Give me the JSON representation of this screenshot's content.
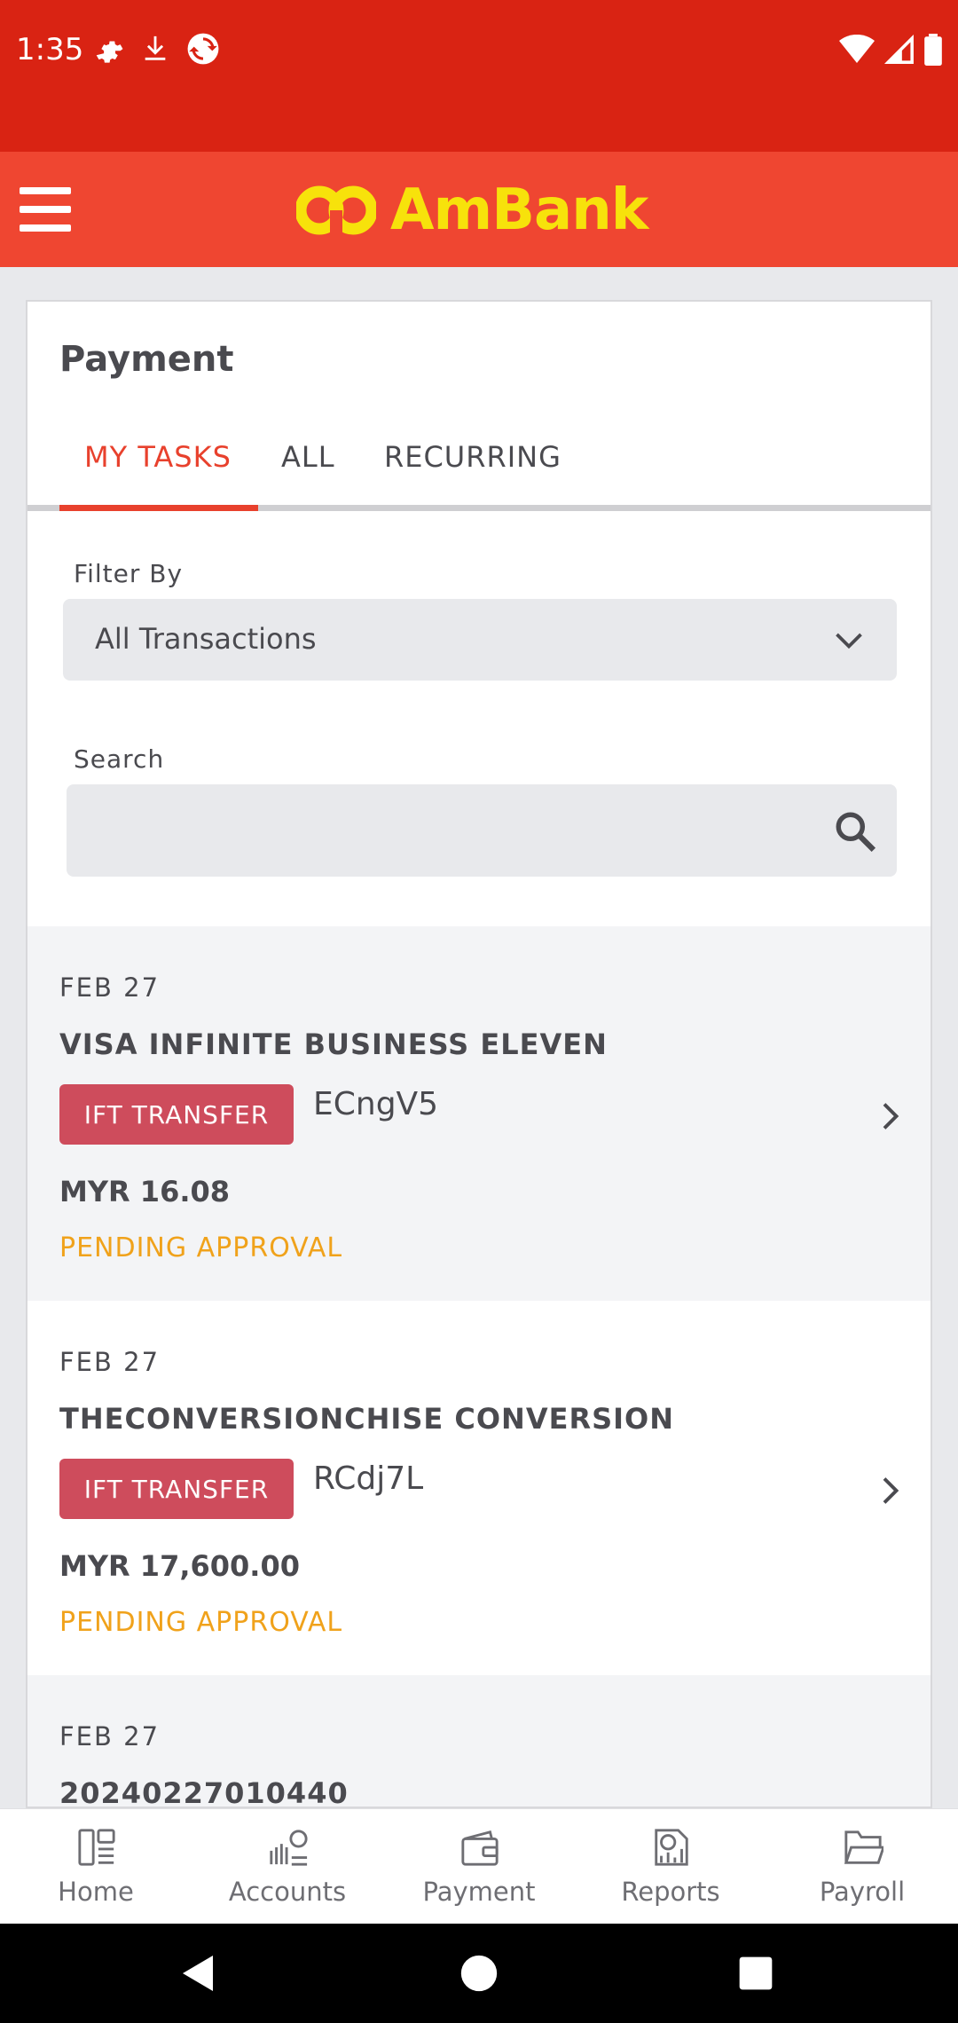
{
  "status_bar": {
    "time": "1:35"
  },
  "header": {
    "brand": "AmBank",
    "brand_color": "#f7e20b",
    "header_color": "#ef4631",
    "status_color": "#d92313"
  },
  "page": {
    "title": "Payment",
    "tabs": [
      {
        "label": "MY TASKS",
        "active": true
      },
      {
        "label": "ALL",
        "active": false
      },
      {
        "label": "RECURRING",
        "active": false
      }
    ],
    "filter": {
      "label": "Filter By",
      "value": "All Transactions"
    },
    "search": {
      "label": "Search",
      "placeholder": ""
    }
  },
  "transactions": [
    {
      "date": "FEB  27",
      "name": "VISA INFINITE BUSINESS ELEVEN",
      "type": "IFT TRANSFER",
      "ref": "ECngV5",
      "amount": "MYR 16.08",
      "status": "PENDING APPROVAL"
    },
    {
      "date": "FEB  27",
      "name": "THECONVERSIONCHISE CONVERSION",
      "type": "IFT TRANSFER",
      "ref": "RCdj7L",
      "amount": "MYR 17,600.00",
      "status": "PENDING APPROVAL"
    },
    {
      "date": "FEB  27",
      "name": "20240227010440",
      "type": "",
      "ref": "",
      "amount": "",
      "status": ""
    }
  ],
  "bottom_nav": [
    {
      "label": "Home",
      "icon": "home-icon"
    },
    {
      "label": "Accounts",
      "icon": "accounts-icon"
    },
    {
      "label": "Payment",
      "icon": "wallet-icon"
    },
    {
      "label": "Reports",
      "icon": "reports-icon"
    },
    {
      "label": "Payroll",
      "icon": "folder-icon"
    }
  ]
}
